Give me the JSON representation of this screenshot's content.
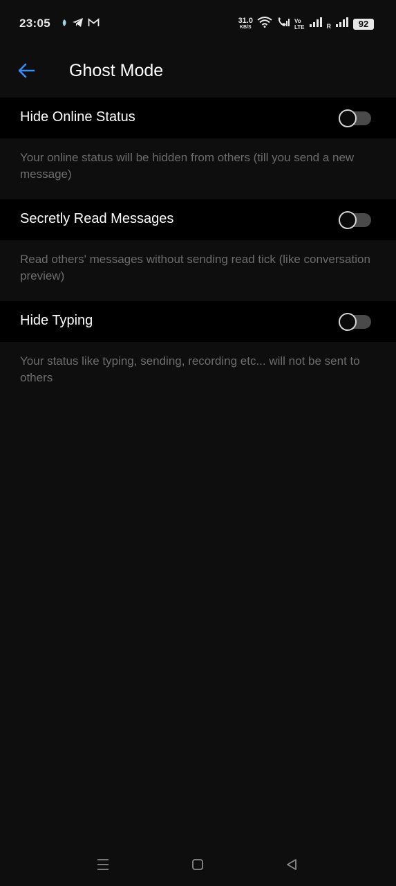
{
  "status_bar": {
    "time": "23:05",
    "speed_value": "31.0",
    "speed_unit": "KB/S",
    "volte_top": "Vo",
    "volte_bottom": "LTE",
    "roaming": "R",
    "battery": "92",
    "left_icons": [
      "notification-dot-icon",
      "telegram-icon",
      "gmail-icon"
    ],
    "right_icons": [
      "wifi-icon",
      "wifi-call-icon",
      "signal-icon",
      "signal-icon-2"
    ]
  },
  "app_bar": {
    "title": "Ghost Mode",
    "back_icon": "arrow-left-icon",
    "accent": "#3a8ef6"
  },
  "settings": [
    {
      "label": "Hide Online Status",
      "description": "Your online status will be hidden from others (till you send a new message)",
      "enabled": false
    },
    {
      "label": "Secretly Read Messages",
      "description": "Read others' messages without sending read tick (like conversation preview)",
      "enabled": false
    },
    {
      "label": "Hide Typing",
      "description": "Your status like typing, sending, recording etc... will not be sent to others",
      "enabled": false
    }
  ],
  "nav_bar": {
    "icons": [
      "menu-icon",
      "home-square-icon",
      "back-triangle-icon"
    ]
  }
}
